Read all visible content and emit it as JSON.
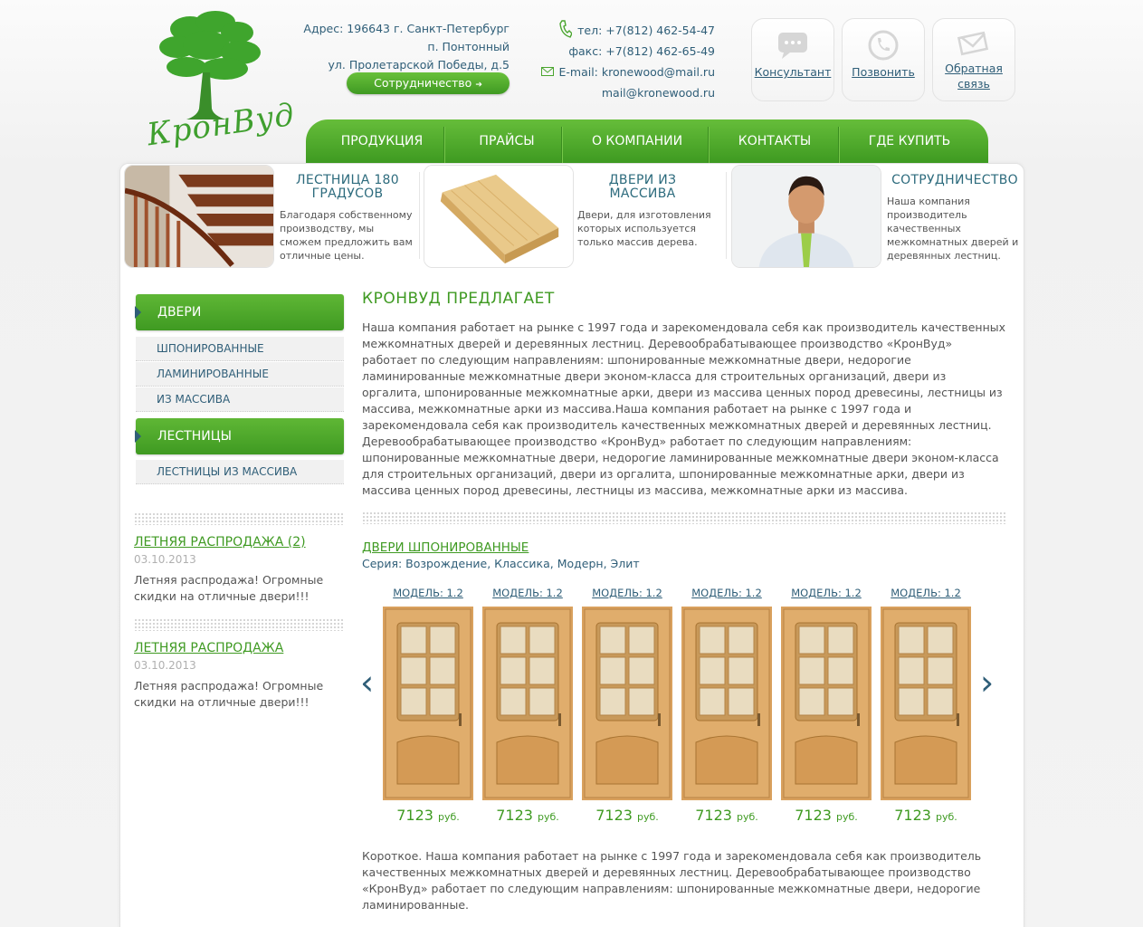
{
  "header": {
    "logo_text": "КронВуд",
    "address": [
      "Адрес: 196643 г. Санкт-Петербург",
      "п. Понтонный",
      "ул. Пролетарской Победы, д.5"
    ],
    "coop_button": "Сотрудничество",
    "phone": "тел: +7(812) 462-54-47",
    "fax": "факс: +7(812) 462-65-49",
    "email1": "E-mail: kronewood@mail.ru",
    "email2": "mail@kronewood.ru",
    "boxes": [
      {
        "label": "Консультант",
        "icon": "chat-icon"
      },
      {
        "label": "Позвонить",
        "icon": "phone-icon"
      },
      {
        "label": "Обратная связь",
        "icon": "mail-icon"
      }
    ]
  },
  "nav": [
    "ПРОДУКЦИЯ",
    "ПРАЙСЫ",
    "О КОМПАНИИ",
    "КОНТАКТЫ",
    "ГДЕ КУПИТЬ"
  ],
  "banners": [
    {
      "title": "ЛЕСТНИЦА 180 ГРАДУСОВ",
      "text": "Благодаря собственному производству, мы сможем предложить вам отличные цены."
    },
    {
      "title": "ДВЕРИ ИЗ МАССИВА",
      "text": "Двери, для изготовления которых используется только массив дерева."
    },
    {
      "title": "СОТРУДНИЧЕСТВО",
      "text": "Наша компания производитель качественных межкомнатных дверей и деревянных лестниц."
    }
  ],
  "sidebar": {
    "doors_head": "ДВЕРИ",
    "doors_items": [
      "ШПОНИРОВАННЫЕ",
      "ЛАМИНИРОВАННЫЕ",
      "ИЗ МАССИВА"
    ],
    "stairs_head": "ЛЕСТНИЦЫ",
    "stairs_items": [
      "ЛЕСТНИЦЫ ИЗ МАССИВА"
    ]
  },
  "news": [
    {
      "title": "ЛЕТНЯЯ РАСПРОДАЖА (2)",
      "date": "03.10.2013",
      "text": "Летняя распродажа! Огромные скидки на отличные двери!!!"
    },
    {
      "title": "ЛЕТНЯЯ РАСПРОДАЖА",
      "date": "03.10.2013",
      "text": "Летняя распродажа! Огромные скидки на отличные двери!!!"
    }
  ],
  "content": {
    "title": "КРОНВУД ПРЕДЛАГАЕТ",
    "text": "Наша компания работает на рынке с 1997 года и зарекомендовала себя как производитель качественных межкомнатных дверей и деревянных лестниц. Деревообрабатывающее производство «КронВуд» работает по следующим направлениям: шпонированные межкомнатные двери, недорогие ламинированные межкомнатные двери эконом-класса для строительных организаций, двери из оргалита, шпонированные межкомнатные арки, двери из массива ценных пород древесины, лестницы из массива, межкомнатные арки из массива.Наша компания работает на рынке с 1997 года и зарекомендовала себя как производитель качественных межкомнатных дверей и деревянных лестниц. Деревообрабатывающее производство «КронВуд» работает по следующим направлениям: шпонированные межкомнатные двери, недорогие ламинированные межкомнатные двери эконом-класса для строительных организаций, двери из оргалита, шпонированные межкомнатные арки, двери из массива ценных пород древесины, лестницы из массива, межкомнатные арки из массива.",
    "section_link": "ДВЕРИ ШПОНИРОВАННЫЕ",
    "series": "Серия: Возрождение, Классика, Модерн, Элит",
    "products": [
      {
        "model": "МОДЕЛЬ: 1.2",
        "price": "7123",
        "currency": "руб."
      },
      {
        "model": "МОДЕЛЬ: 1.2",
        "price": "7123",
        "currency": "руб."
      },
      {
        "model": "МОДЕЛЬ: 1.2",
        "price": "7123",
        "currency": "руб."
      },
      {
        "model": "МОДЕЛЬ: 1.2",
        "price": "7123",
        "currency": "руб."
      },
      {
        "model": "МОДЕЛЬ: 1.2",
        "price": "7123",
        "currency": "руб."
      },
      {
        "model": "МОДЕЛЬ: 1.2",
        "price": "7123",
        "currency": "руб."
      }
    ],
    "short_text": "Короткое. Наша компания работает на рынке с 1997 года и зарекомендовала себя как производитель качественных межкомнатных дверей и деревянных лестниц. Деревообрабатывающее производство «КронВуд» работает по следующим направлениям: шпонированные межкомнатные двери, недорогие ламинированные."
  },
  "colors": {
    "brand_green": "#3f9a22",
    "link_blue": "#2f5e78"
  }
}
